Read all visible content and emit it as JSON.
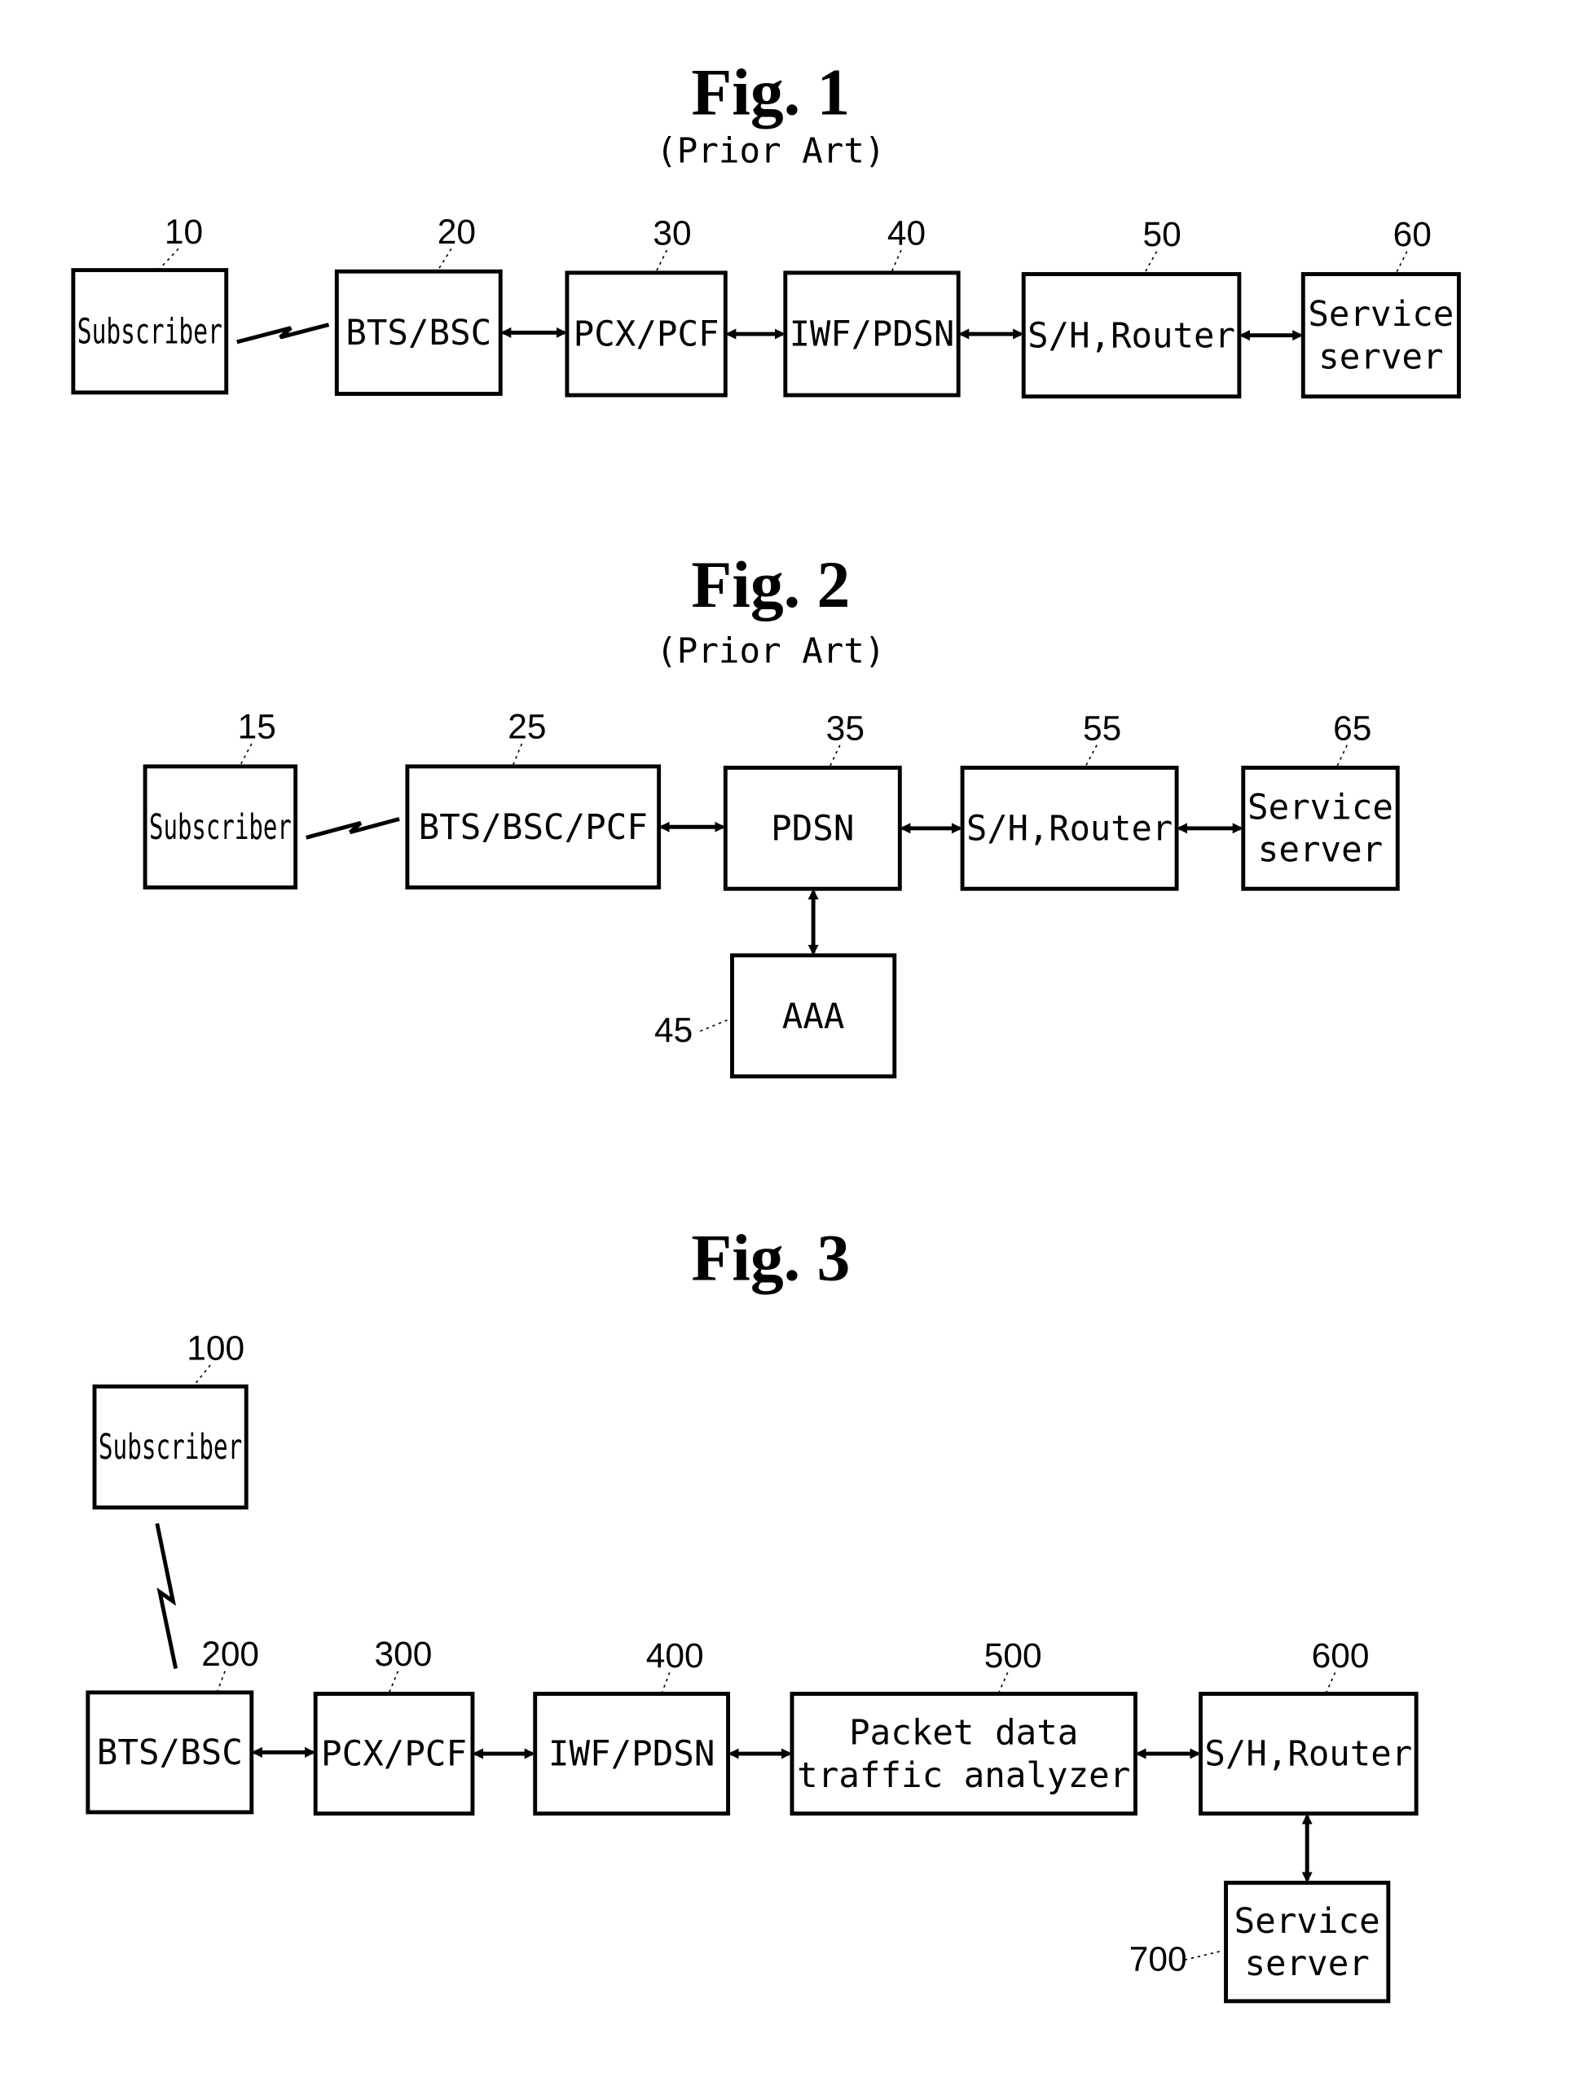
{
  "figures": [
    {
      "title": "Fig. 1",
      "subtitle": "(Prior Art)",
      "nodes": [
        {
          "ref": "10",
          "lines": [
            "Subscriber"
          ]
        },
        {
          "ref": "20",
          "lines": [
            "BTS/BSC"
          ]
        },
        {
          "ref": "30",
          "lines": [
            "PCX/PCF"
          ]
        },
        {
          "ref": "40",
          "lines": [
            "IWF/PDSN"
          ]
        },
        {
          "ref": "50",
          "lines": [
            "S/H,Router"
          ]
        },
        {
          "ref": "60",
          "lines": [
            "Service",
            "server"
          ]
        }
      ],
      "links": [
        {
          "from": "10",
          "to": "20",
          "type": "wireless"
        },
        {
          "from": "20",
          "to": "30",
          "type": "bidirectional"
        },
        {
          "from": "30",
          "to": "40",
          "type": "bidirectional"
        },
        {
          "from": "40",
          "to": "50",
          "type": "bidirectional"
        },
        {
          "from": "50",
          "to": "60",
          "type": "bidirectional"
        }
      ]
    },
    {
      "title": "Fig. 2",
      "subtitle": "(Prior Art)",
      "nodes": [
        {
          "ref": "15",
          "lines": [
            "Subscriber"
          ]
        },
        {
          "ref": "25",
          "lines": [
            "BTS/BSC/PCF"
          ]
        },
        {
          "ref": "35",
          "lines": [
            "PDSN"
          ]
        },
        {
          "ref": "55",
          "lines": [
            "S/H,Router"
          ]
        },
        {
          "ref": "65",
          "lines": [
            "Service",
            "server"
          ]
        },
        {
          "ref": "45",
          "lines": [
            "AAA"
          ]
        }
      ],
      "links": [
        {
          "from": "15",
          "to": "25",
          "type": "wireless"
        },
        {
          "from": "25",
          "to": "35",
          "type": "bidirectional"
        },
        {
          "from": "35",
          "to": "55",
          "type": "bidirectional"
        },
        {
          "from": "55",
          "to": "65",
          "type": "bidirectional"
        },
        {
          "from": "35",
          "to": "45",
          "type": "bidirectional"
        }
      ]
    },
    {
      "title": "Fig. 3",
      "subtitle": "",
      "nodes": [
        {
          "ref": "100",
          "lines": [
            "Subscriber"
          ]
        },
        {
          "ref": "200",
          "lines": [
            "BTS/BSC"
          ]
        },
        {
          "ref": "300",
          "lines": [
            "PCX/PCF"
          ]
        },
        {
          "ref": "400",
          "lines": [
            "IWF/PDSN"
          ]
        },
        {
          "ref": "500",
          "lines": [
            "Packet data",
            "traffic analyzer"
          ]
        },
        {
          "ref": "600",
          "lines": [
            "S/H,Router"
          ]
        },
        {
          "ref": "700",
          "lines": [
            "Service",
            "server"
          ]
        }
      ],
      "links": [
        {
          "from": "100",
          "to": "200",
          "type": "wireless"
        },
        {
          "from": "200",
          "to": "300",
          "type": "bidirectional"
        },
        {
          "from": "300",
          "to": "400",
          "type": "bidirectional"
        },
        {
          "from": "400",
          "to": "500",
          "type": "bidirectional"
        },
        {
          "from": "500",
          "to": "600",
          "type": "bidirectional"
        },
        {
          "from": "600",
          "to": "700",
          "type": "bidirectional"
        }
      ]
    }
  ]
}
